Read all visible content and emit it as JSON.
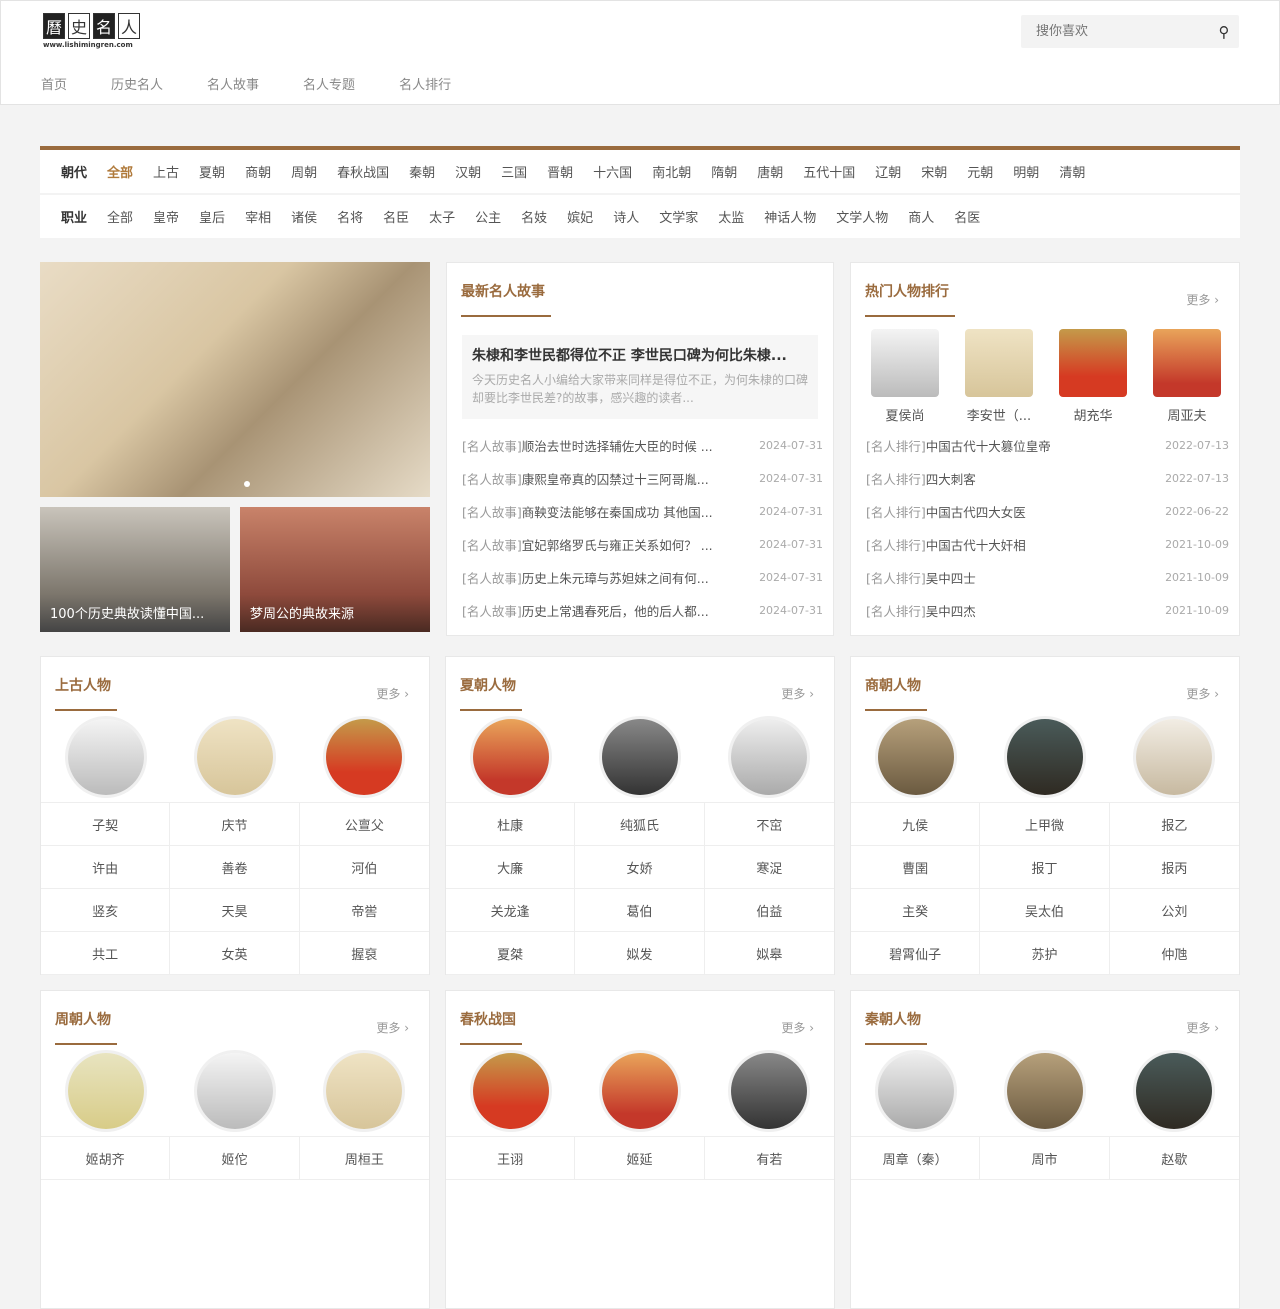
{
  "header": {
    "logo_chars": [
      "曆",
      "史",
      "名",
      "人"
    ],
    "logo_url": "www.lishimingren.com",
    "search_placeholder": "搜你喜欢",
    "nav": [
      "首页",
      "历史名人",
      "名人故事",
      "名人专题",
      "名人排行"
    ]
  },
  "filters": {
    "dynasty_label": "朝代",
    "dynasties": [
      "全部",
      "上古",
      "夏朝",
      "商朝",
      "周朝",
      "春秋战国",
      "秦朝",
      "汉朝",
      "三国",
      "晋朝",
      "十六国",
      "南北朝",
      "隋朝",
      "唐朝",
      "五代十国",
      "辽朝",
      "宋朝",
      "元朝",
      "明朝",
      "清朝"
    ],
    "job_label": "职业",
    "jobs": [
      "全部",
      "皇帝",
      "皇后",
      "宰相",
      "诸侯",
      "名将",
      "名臣",
      "太子",
      "公主",
      "名妓",
      "嫔妃",
      "诗人",
      "文学家",
      "太监",
      "神话人物",
      "文学人物",
      "商人",
      "名医"
    ]
  },
  "thumbs": [
    "100个历史典故读懂中国...",
    "梦周公的典故来源"
  ],
  "stories": {
    "title": "最新名人故事",
    "featured_title": "朱棣和李世民都得位不正 李世民口碑为何比朱棣...",
    "featured_desc": "今天历史名人小编给大家带来同样是得位不正，为何朱棣的口碑却要比李世民差?的故事，感兴趣的读者...",
    "items": [
      {
        "tag": "[名人故事]",
        "text": "顺治去世时选择辅佐大臣的时候 ...",
        "date": "2024-07-31"
      },
      {
        "tag": "[名人故事]",
        "text": "康熙皇帝真的囚禁过十三阿哥胤...",
        "date": "2024-07-31"
      },
      {
        "tag": "[名人故事]",
        "text": "商鞅变法能够在秦国成功 其他国...",
        "date": "2024-07-31"
      },
      {
        "tag": "[名人故事]",
        "text": "宜妃郭络罗氏与雍正关系如何？ ...",
        "date": "2024-07-31"
      },
      {
        "tag": "[名人故事]",
        "text": "历史上朱元璋与苏妲妹之间有何...",
        "date": "2024-07-31"
      },
      {
        "tag": "[名人故事]",
        "text": "历史上常遇春死后，他的后人都...",
        "date": "2024-07-31"
      }
    ]
  },
  "ranking": {
    "title": "热门人物排行",
    "more": "更多 ›",
    "people": [
      "夏侯尚",
      "李安世（...",
      "胡充华",
      "周亚夫"
    ],
    "items": [
      {
        "tag": "[名人排行]",
        "text": "中国古代十大篡位皇帝",
        "date": "2022-07-13"
      },
      {
        "tag": "[名人排行]",
        "text": "四大刺客",
        "date": "2022-07-13"
      },
      {
        "tag": "[名人排行]",
        "text": "中国古代四大女医",
        "date": "2022-06-22"
      },
      {
        "tag": "[名人排行]",
        "text": "中国古代十大奸相",
        "date": "2021-10-09"
      },
      {
        "tag": "[名人排行]",
        "text": "吴中四士",
        "date": "2021-10-09"
      },
      {
        "tag": "[名人排行]",
        "text": "吴中四杰",
        "date": "2021-10-09"
      }
    ]
  },
  "sections": [
    {
      "title": "上古人物",
      "more": "更多 ›",
      "names": [
        "子契",
        "庆节",
        "公亶父",
        "许由",
        "善卷",
        "河伯",
        "竖亥",
        "天昊",
        "帝喾",
        "共工",
        "女英",
        "握裒"
      ]
    },
    {
      "title": "夏朝人物",
      "more": "更多 ›",
      "names": [
        "杜康",
        "纯狐氏",
        "不窋",
        "大廉",
        "女娇",
        "寒浞",
        "关龙逢",
        "葛伯",
        "伯益",
        "夏桀",
        "姒发",
        "姒皋"
      ]
    },
    {
      "title": "商朝人物",
      "more": "更多 ›",
      "names": [
        "九侯",
        "上甲微",
        "报乙",
        "曹圉",
        "报丁",
        "报丙",
        "主癸",
        "吴太伯",
        "公刘",
        "碧霄仙子",
        "苏护",
        "仲虺"
      ]
    },
    {
      "title": "周朝人物",
      "more": "更多 ›",
      "names": [
        "姬胡齐",
        "姬佗",
        "周桓王"
      ]
    },
    {
      "title": "春秋战国",
      "more": "更多 ›",
      "names": [
        "王诩",
        "姬延",
        "有若"
      ]
    },
    {
      "title": "秦朝人物",
      "more": "更多 ›",
      "names": [
        "周章（秦）",
        "周市",
        "赵歇"
      ]
    }
  ],
  "colors": {
    "accent": "#9a6b3e"
  }
}
